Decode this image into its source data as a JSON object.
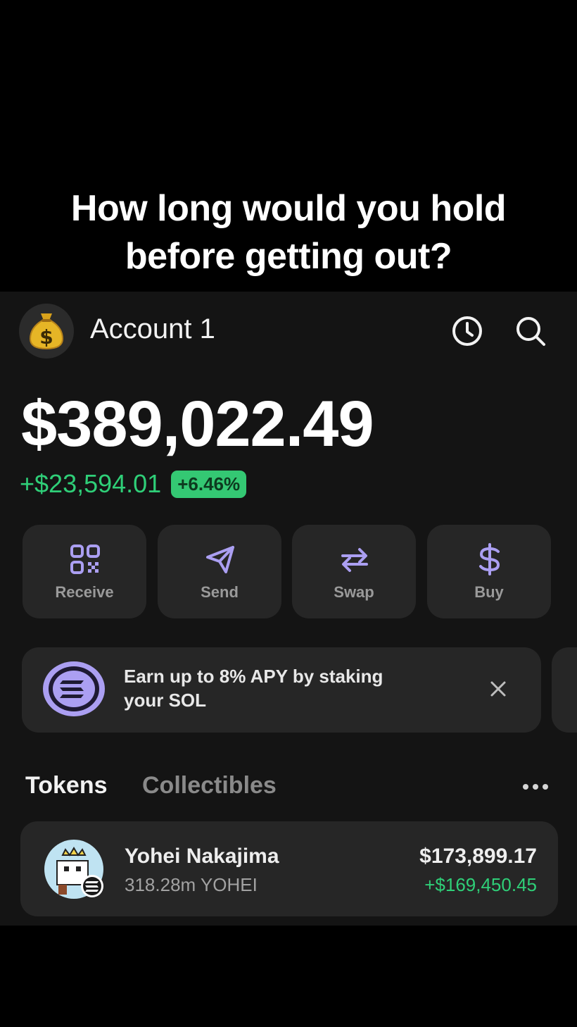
{
  "caption": {
    "line1": "How long would you hold",
    "line2": "before getting out?"
  },
  "header": {
    "account_name": "Account 1",
    "avatar_symbol": "$",
    "avatar_icon": "money-bag-icon",
    "history_icon": "clock-icon",
    "search_icon": "search-icon"
  },
  "balance": {
    "total": "$389,022.49",
    "change_amount": "+$23,594.01",
    "change_percent": "+6.46%"
  },
  "actions": [
    {
      "label": "Receive",
      "icon": "qr-code-icon"
    },
    {
      "label": "Send",
      "icon": "paper-plane-icon"
    },
    {
      "label": "Swap",
      "icon": "swap-arrows-icon"
    },
    {
      "label": "Buy",
      "icon": "dollar-icon"
    }
  ],
  "promo": {
    "line1": "Earn up to 8% APY by staking",
    "line2": "your SOL",
    "icon": "solana-icon",
    "close_icon": "close-icon"
  },
  "tabs": {
    "active": "Tokens",
    "inactive": "Collectibles",
    "more_icon": "more-horizontal-icon"
  },
  "tokens": [
    {
      "name": "Yohei Nakajima",
      "amount": "318.28m YOHEI",
      "value": "$173,899.17",
      "change": "+$169,450.45"
    }
  ],
  "colors": {
    "background": "#000000",
    "app_background": "#141414",
    "card": "#262626",
    "positive": "#2fcf78",
    "accent_purple": "#ab9ff2"
  }
}
